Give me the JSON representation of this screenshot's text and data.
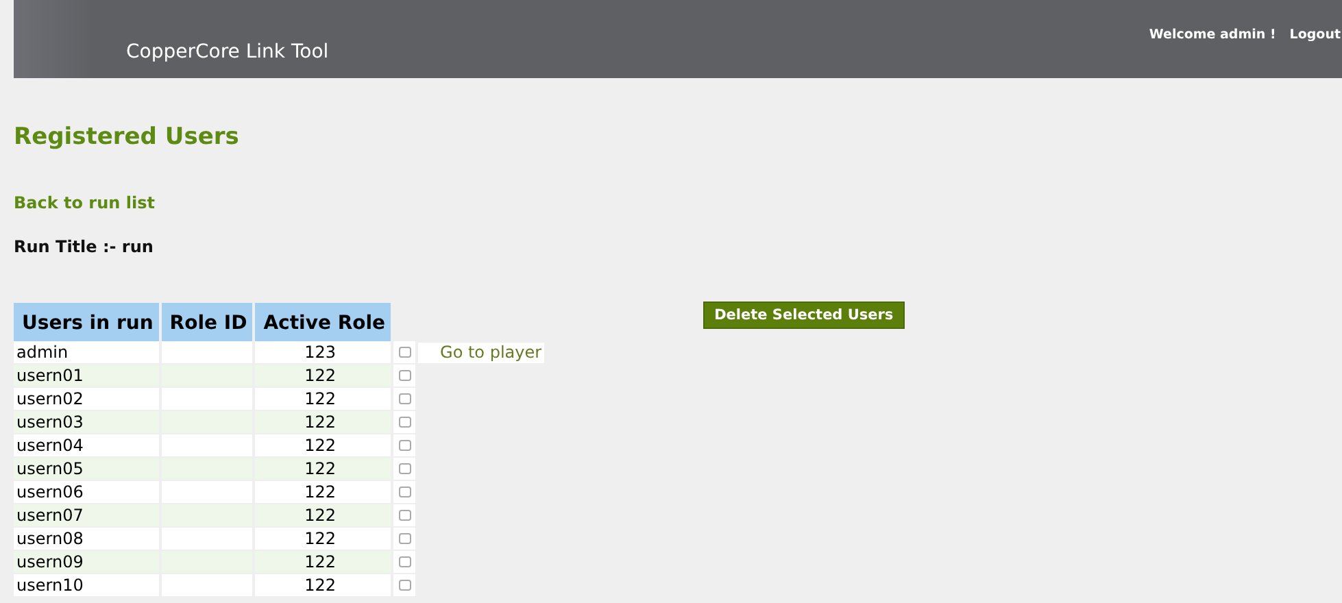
{
  "header": {
    "title": "CopperCore Link Tool",
    "welcome": "Welcome admin !",
    "logout": "Logout"
  },
  "heading": "Registered Users",
  "back_link": "Back to run list",
  "run_title": "Run Title :- run",
  "delete_button": "Delete Selected Users",
  "table": {
    "columns": [
      "Users in run",
      "Role ID",
      "Active Role"
    ],
    "rows": [
      {
        "user": "admin",
        "active_role": "123",
        "checked": false,
        "link": "Go to player"
      },
      {
        "user": "usern01",
        "active_role": "122",
        "checked": false
      },
      {
        "user": "usern02",
        "active_role": "122",
        "checked": false
      },
      {
        "user": "usern03",
        "active_role": "122",
        "checked": false
      },
      {
        "user": "usern04",
        "active_role": "122",
        "checked": false
      },
      {
        "user": "usern05",
        "active_role": "122",
        "checked": false
      },
      {
        "user": "usern06",
        "active_role": "122",
        "checked": false
      },
      {
        "user": "usern07",
        "active_role": "122",
        "checked": false
      },
      {
        "user": "usern08",
        "active_role": "122",
        "checked": false
      },
      {
        "user": "usern09",
        "active_role": "122",
        "checked": false
      },
      {
        "user": "usern10",
        "active_role": "122",
        "checked": false
      }
    ]
  }
}
